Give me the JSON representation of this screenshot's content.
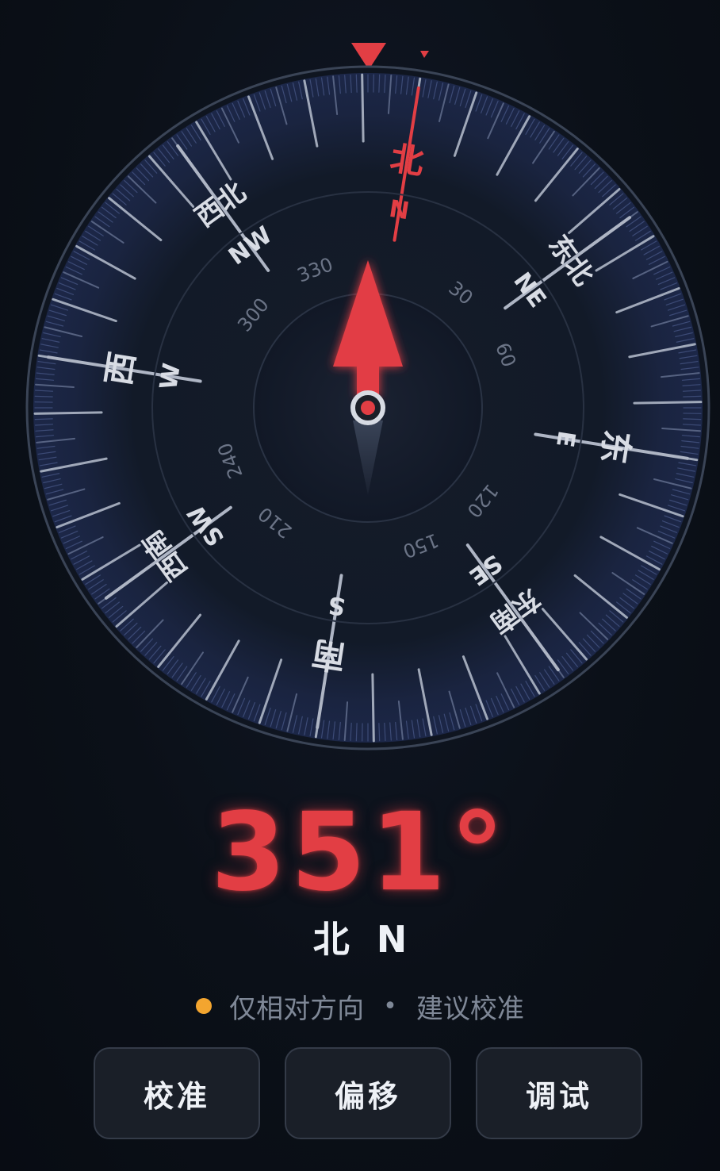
{
  "compass": {
    "heading_deg": 351,
    "cardinals": [
      {
        "angle": 0,
        "zh": "北",
        "en": "N"
      },
      {
        "angle": 45,
        "zh": "东北",
        "en": "NE"
      },
      {
        "angle": 90,
        "zh": "东",
        "en": "E"
      },
      {
        "angle": 135,
        "zh": "东南",
        "en": "SE"
      },
      {
        "angle": 180,
        "zh": "南",
        "en": "S"
      },
      {
        "angle": 225,
        "zh": "西南",
        "en": "SW"
      },
      {
        "angle": 270,
        "zh": "西",
        "en": "W"
      },
      {
        "angle": 315,
        "zh": "西北",
        "en": "NW"
      }
    ],
    "degree_labels": [
      {
        "angle": 30,
        "text": "30"
      },
      {
        "angle": 60,
        "text": "60"
      },
      {
        "angle": 120,
        "text": "120"
      },
      {
        "angle": 150,
        "text": "150"
      },
      {
        "angle": 210,
        "text": "210"
      },
      {
        "angle": 240,
        "text": "240"
      },
      {
        "angle": 300,
        "text": "300"
      },
      {
        "angle": 330,
        "text": "330"
      }
    ],
    "colors": {
      "accent": "#e23e44",
      "bezel": "#3a4456",
      "tick_major": "#b8c0cf",
      "tick_minor": "#4a5a8a",
      "label": "#d8dce4"
    }
  },
  "readout": {
    "degrees": "351°",
    "direction": "北 N"
  },
  "status": {
    "indicator_color": "#f3a52f",
    "text_left": "仅相对方向",
    "separator": "•",
    "text_right": "建议校准"
  },
  "actions": {
    "calibrate_label": "校准",
    "offset_label": "偏移",
    "debug_label": "调试"
  }
}
